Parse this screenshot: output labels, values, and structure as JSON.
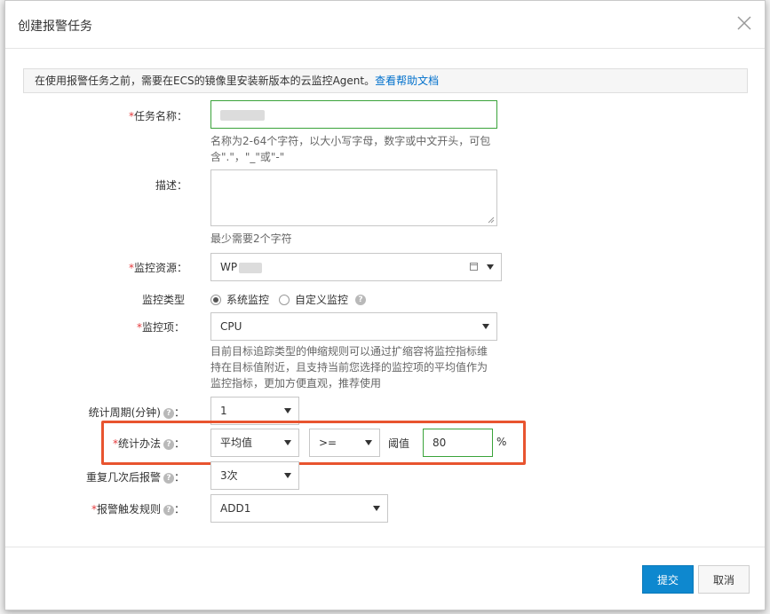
{
  "dialog": {
    "title": "创建报警任务"
  },
  "notice": {
    "text": "在使用报警任务之前，需要在ECS的镜像里安装新版本的云监控Agent。",
    "link": "查看帮助文档"
  },
  "form": {
    "task_name": {
      "required_mark": "*",
      "label": "任务名称：",
      "hint_line1": "名称为2-64个字符，以大小写字母，数字或中文开头，可包",
      "hint_line2": "含\".\"，\"_\"或\"-\""
    },
    "description": {
      "label": "描述：",
      "hint": "最少需要2个字符"
    },
    "resource": {
      "required_mark": "*",
      "label": "监控资源：",
      "value_prefix": "WP"
    },
    "monitor_type": {
      "label": "监控类型",
      "options": [
        "系统监控",
        "自定义监控"
      ],
      "selected": "系统监控"
    },
    "metric": {
      "required_mark": "*",
      "label": "监控项：",
      "value": "CPU",
      "hint_line1": "目前目标追踪类型的伸缩规则可以通过扩缩容将监控指标维",
      "hint_line2": "持在目标值附近，且支持当前您选择的监控项的平均值作为",
      "hint_line3": "监控指标，更加方便直观，推荐使用"
    },
    "period": {
      "label": "统计周期(分钟)",
      "suffix": "：",
      "value": "1"
    },
    "statistic": {
      "required_mark": "*",
      "label": "统计办法",
      "suffix": "：",
      "method": "平均值",
      "operator": ">=",
      "threshold_label": "阈值",
      "threshold_value": "80",
      "unit": "%"
    },
    "repeat": {
      "label": "重复几次后报警",
      "suffix": "：",
      "value": "3次"
    },
    "trigger_rule": {
      "required_mark": "*",
      "label": "报警触发规则",
      "suffix": "：",
      "value": "ADD1"
    }
  },
  "footer": {
    "submit": "提交",
    "cancel": "取消"
  },
  "colors": {
    "primary": "#0e88cf",
    "highlight": "#e8542f",
    "required": "#e4393c",
    "link": "#0070cc",
    "focus": "#3aa33a"
  }
}
